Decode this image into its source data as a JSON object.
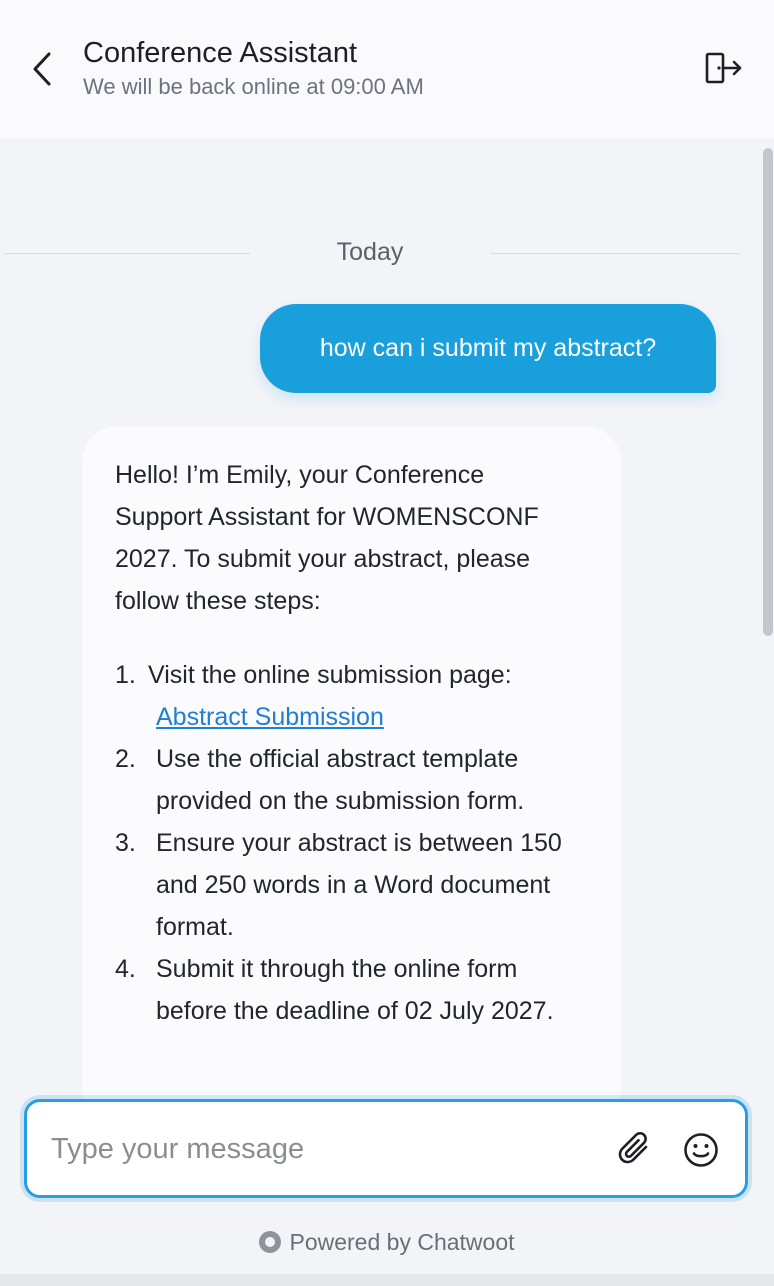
{
  "header": {
    "title": "Conference Assistant",
    "subtitle": "We will be back online at 09:00 AM"
  },
  "conversation": {
    "date_divider": "Today",
    "user_message": "how can i submit my abstract?",
    "bot_message": {
      "intro": "Hello! I’m Emily, your Conference Support Assistant for WOMENSCONF 2027. To submit your abstract, please follow these steps:",
      "steps": [
        {
          "number": "1.",
          "text": "Visit the online submission page:",
          "link": "Abstract Submission"
        },
        {
          "number": "2.",
          "text": "Use the official abstract template provided on the submission form."
        },
        {
          "number": "3.",
          "text": "Ensure your abstract is between 150 and 250 words in a Word document format."
        },
        {
          "number": "4.",
          "text": "Submit it through the online form before the deadline of 02 July 2027."
        }
      ]
    }
  },
  "composer": {
    "placeholder": "Type your message",
    "value": ""
  },
  "footer": {
    "powered_by": "Powered by Chatwoot"
  },
  "icons": {
    "back": "chevron-left-icon",
    "exit": "exit-door-icon",
    "attach": "paperclip-icon",
    "emoji": "smiley-icon",
    "logo": "chatwoot-logo-icon"
  },
  "colors": {
    "accent": "#1a9fdd",
    "link": "#1f7ed6",
    "composer_border": "#2a9ee0"
  }
}
